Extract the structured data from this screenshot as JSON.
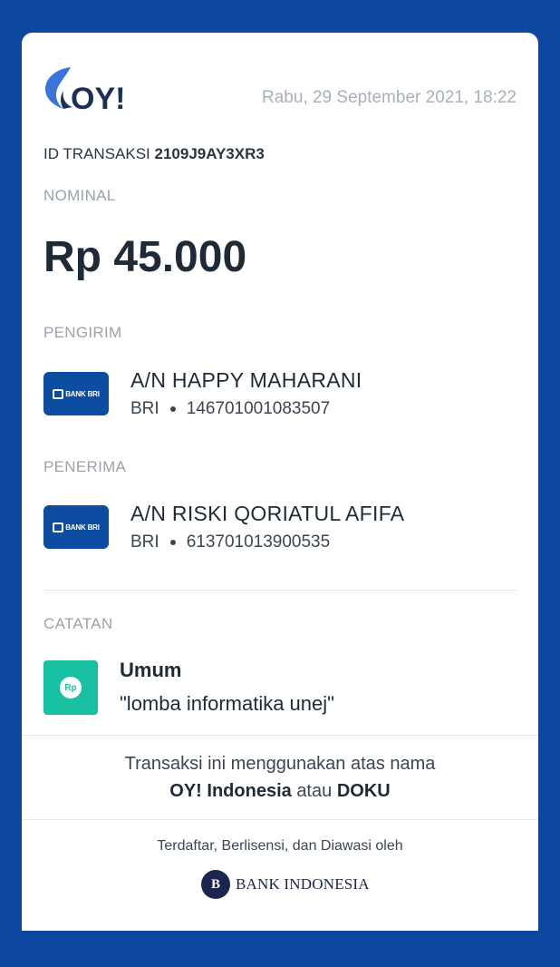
{
  "brand": {
    "logo_text": "OY!",
    "colors": {
      "background": "#0d47a1",
      "logo_dark": "#1b2f59",
      "logo_blue": "#3a74d8",
      "bank_blue": "#0c4da2",
      "note_green": "#18c1a2"
    }
  },
  "receipt": {
    "datetime": "Rabu, 29 September 2021, 18:22",
    "transaction_id_label": "ID TRANSAKSI",
    "transaction_id_value": "2109J9AY3XR3",
    "nominal_label": "NOMINAL",
    "amount": "Rp 45.000",
    "sender": {
      "section_label": "PENGIRIM",
      "bank_logo_text": "BANK BRI",
      "name": "A/N HAPPY MAHARANI",
      "bank": "BRI",
      "account": "146701001083507"
    },
    "recipient": {
      "section_label": "PENERIMA",
      "bank_logo_text": "BANK BRI",
      "name": "A/N RISKI QORIATUL AFIFA",
      "bank": "BRI",
      "account": "613701013900535"
    },
    "note": {
      "section_label": "CATATAN",
      "icon_text": "Rp",
      "title": "Umum",
      "text": "\"lomba informatika unej\""
    }
  },
  "footer": {
    "line1": "Transaksi ini menggunakan atas nama",
    "company1": "OY! Indonesia",
    "connector": "atau",
    "company2": "DOKU",
    "regulated_text": "Terdaftar, Berlisensi, dan Diawasi oleh",
    "regulator_seal": "B",
    "regulator_name": "BANK INDONESIA"
  }
}
